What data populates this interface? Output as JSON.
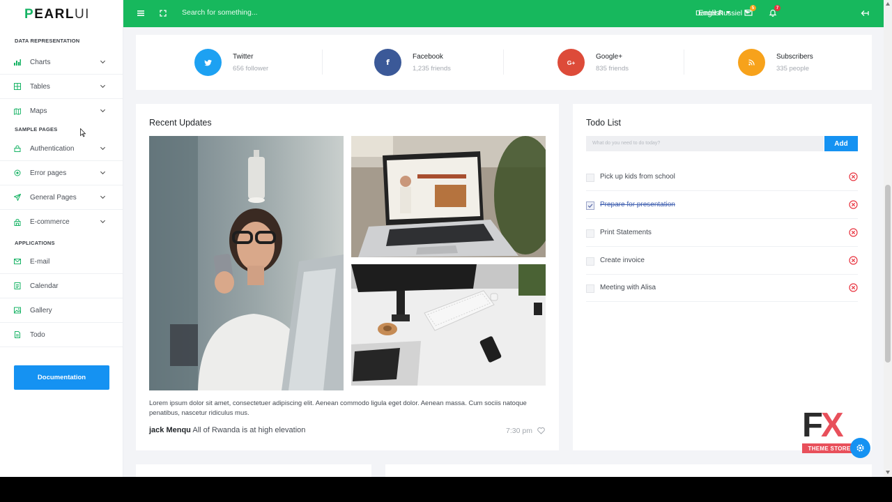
{
  "brand": {
    "logo_text": "PEARLUI"
  },
  "sidebar": {
    "section_data": "DATA REPRESENTATION",
    "section_samples": "SAMPLE PAGES",
    "section_apps": "APPLICATIONS",
    "data_items": [
      {
        "label": "Charts",
        "icon": "bar-chart-icon"
      },
      {
        "label": "Tables",
        "icon": "table-icon"
      },
      {
        "label": "Maps",
        "icon": "map-icon"
      }
    ],
    "sample_items": [
      {
        "label": "Authentication",
        "icon": "lock-icon"
      },
      {
        "label": "Error pages",
        "icon": "bug-icon"
      },
      {
        "label": "General Pages",
        "icon": "send-icon"
      },
      {
        "label": "E-commerce",
        "icon": "shop-icon"
      }
    ],
    "app_items": [
      {
        "label": "E-mail",
        "icon": "mail-icon"
      },
      {
        "label": "Calendar",
        "icon": "calendar-icon"
      },
      {
        "label": "Gallery",
        "icon": "image-icon"
      },
      {
        "label": "Todo",
        "icon": "file-icon"
      }
    ],
    "documentation_label": "Documentation"
  },
  "topbar": {
    "search_placeholder": "Search for something...",
    "language": "English",
    "mail_badge": "5",
    "bell_badge": "7",
    "user_name": "Daniel Russiel"
  },
  "social": [
    {
      "name": "Twitter",
      "count": "656 follower",
      "icon": "twitter-icon",
      "color": "#1da1f2"
    },
    {
      "name": "Facebook",
      "count": "1,235 friends",
      "icon": "facebook-icon",
      "color": "#3b5998"
    },
    {
      "name": "Google+",
      "count": "835 friends",
      "icon": "google-plus-icon",
      "color": "#dd4b39"
    },
    {
      "name": "Subscribers",
      "count": "335 people",
      "icon": "rss-icon",
      "color": "#f7a21b"
    }
  ],
  "updates": {
    "title": "Recent Updates",
    "text": "Lorem ipsum dolor sit amet, consectetuer adipiscing elit. Aenean commodo ligula eget dolor. Aenean massa. Cum sociis natoque penatibus, nascetur ridiculus mus.",
    "author": "jack Menqu",
    "headline": "All of Rwanda is at high elevation",
    "time": "7:30 pm"
  },
  "todo": {
    "title": "Todo List",
    "input_placeholder": "What do you need to do today?",
    "add_label": "Add",
    "items": [
      {
        "label": "Pick up kids from school",
        "done": false
      },
      {
        "label": "Prepare for presentation",
        "done": true
      },
      {
        "label": "Print Statements",
        "done": false
      },
      {
        "label": "Create invoice",
        "done": false
      },
      {
        "label": "Meeting with Alisa",
        "done": false
      }
    ]
  },
  "watermark": {
    "letters_f": "F",
    "letters_x": "X",
    "store": "THEME STORE"
  },
  "colors": {
    "brand_green": "#17b85d",
    "primary_blue": "#1592f2",
    "danger_red": "#e8333f"
  }
}
